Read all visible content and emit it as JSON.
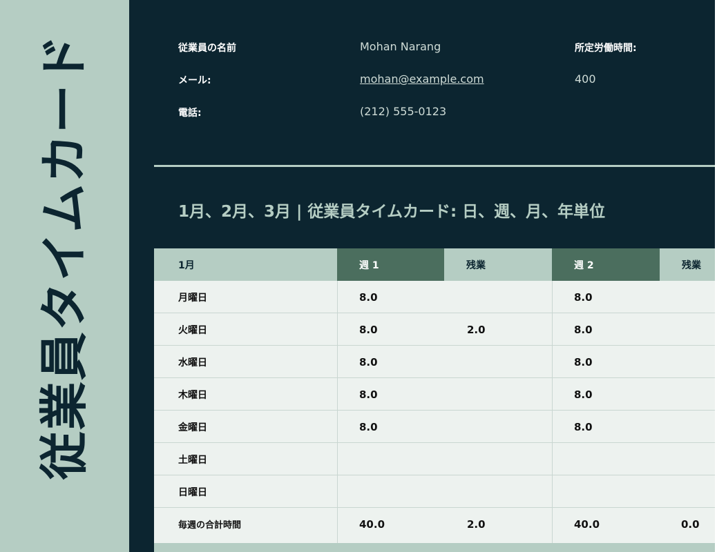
{
  "side_title": "従業員タイムカード",
  "employee": {
    "name_label": "従業員の名前",
    "name_value": "Mohan Narang",
    "email_label": "メール:",
    "email_value": "mohan@example.com",
    "phone_label": "電話:",
    "phone_value": "(212) 555-0123",
    "hours_label": "所定労働時間:",
    "hours_value": "400"
  },
  "section_title": "1月、2月、3月 |  従業員タイムカード: 日、週、月、年単位",
  "table": {
    "headers": {
      "month": "1月",
      "week1": "週 1",
      "overtime1": "残業",
      "week2": "週 2",
      "overtime2": "残業"
    },
    "rows": [
      {
        "day": "月曜日",
        "w1": "8.0",
        "ot1": "",
        "w2": "8.0",
        "ot2": ""
      },
      {
        "day": "火曜日",
        "w1": "8.0",
        "ot1": "2.0",
        "w2": "8.0",
        "ot2": ""
      },
      {
        "day": "水曜日",
        "w1": "8.0",
        "ot1": "",
        "w2": "8.0",
        "ot2": ""
      },
      {
        "day": "木曜日",
        "w1": "8.0",
        "ot1": "",
        "w2": "8.0",
        "ot2": ""
      },
      {
        "day": "金曜日",
        "w1": "8.0",
        "ot1": "",
        "w2": "8.0",
        "ot2": ""
      },
      {
        "day": "土曜日",
        "w1": "",
        "ot1": "",
        "w2": "",
        "ot2": ""
      },
      {
        "day": "日曜日",
        "w1": "",
        "ot1": "",
        "w2": "",
        "ot2": ""
      },
      {
        "day": "毎週の合計時間",
        "w1": "40.0",
        "ot1": "2.0",
        "w2": "40.0",
        "ot2": "0.0"
      }
    ]
  },
  "colors": {
    "dark_panel": "#0c2530",
    "light_accent": "#b5cdc3",
    "week_header": "#4b6e5e",
    "table_bg": "#edf2ef"
  }
}
